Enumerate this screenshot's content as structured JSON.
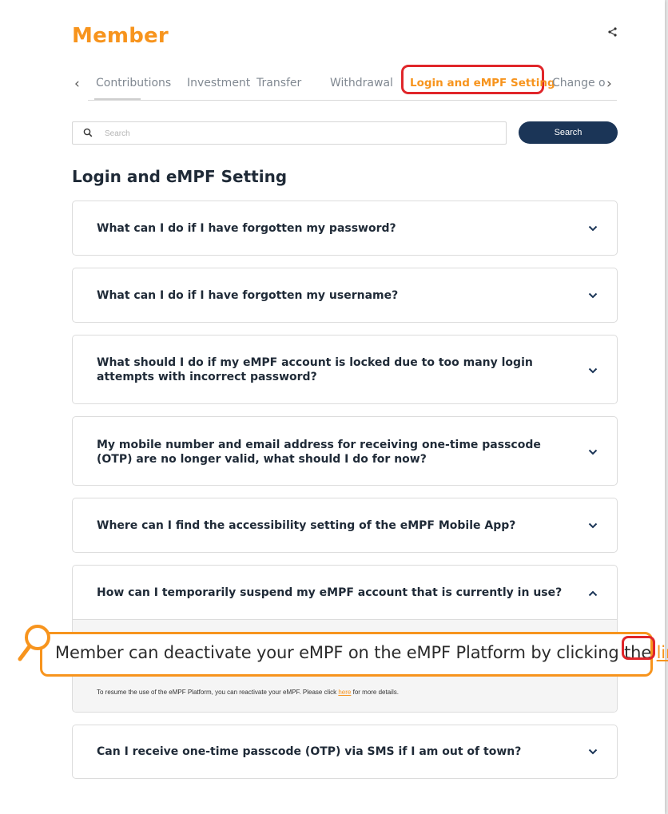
{
  "header": {
    "brand": "Member",
    "share_icon": "share-icon"
  },
  "tabs": {
    "prev_arrow": "‹",
    "next_arrow": "›",
    "items": [
      "Contributions",
      "Investment",
      "Transfer",
      "Withdrawal",
      "Login and eMPF Setting",
      "Change o"
    ],
    "active_index": 4
  },
  "search": {
    "placeholder": "Search",
    "button_label": "Search"
  },
  "section": {
    "title": "Login and eMPF Setting"
  },
  "faqs": [
    {
      "question": "What can I do if I have forgotten my password?"
    },
    {
      "question": "What can I do if I have forgotten my username?"
    },
    {
      "question": "What should I do if my eMPF account is locked due to too many login attempts with incorrect password?"
    },
    {
      "question": "My mobile number and email address for receiving one-time passcode (OTP) are no longer valid, what should I do for now?"
    },
    {
      "question": "Where can I find the accessibility setting of the eMPF Mobile App?"
    },
    {
      "question": "How can I temporarily suspend my eMPF account that is currently in use?",
      "expanded": true,
      "answer_main": "Member can deactivate your eMPF on the eMPF Platform by clicking the ",
      "answer_main_link": "link",
      "answer_main_end": ".",
      "answer_small": "To resume the use of the eMPF Platform, you can reactivate your eMPF. Please click ",
      "answer_small_link": "here",
      "answer_small_end": " for more details."
    },
    {
      "question": "Can I receive one-time passcode (OTP) via SMS if I am out of town?"
    }
  ],
  "colors": {
    "brand_orange": "#f7941d",
    "navy_button": "#1b3557",
    "highlight_red": "#e0262a"
  }
}
